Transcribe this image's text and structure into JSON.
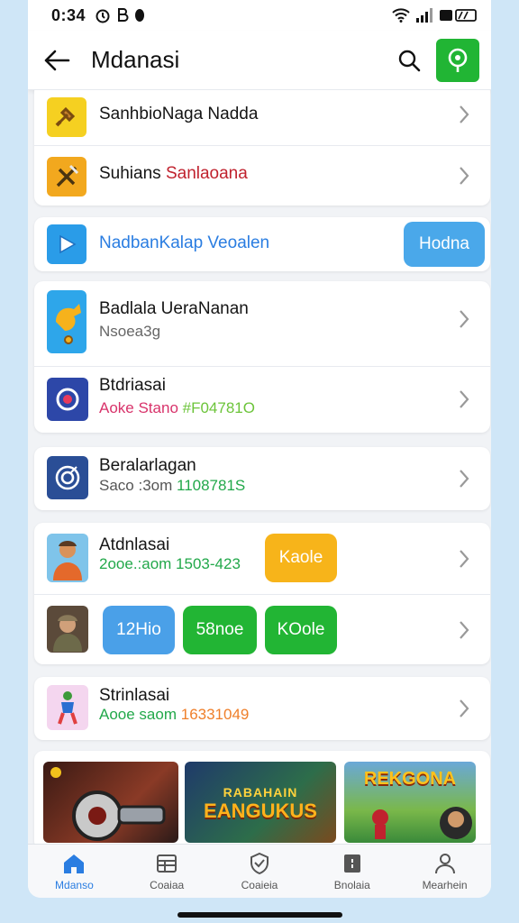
{
  "status_bar": {
    "time": "0:34",
    "left_icons": [
      "alarm-icon",
      "b-icon",
      "dot-icon"
    ],
    "right_icons": [
      "wifi-icon",
      "signal-icon",
      "battery-icon"
    ]
  },
  "header": {
    "title": "Mdanasi"
  },
  "card1": {
    "items": [
      {
        "title": "SanhbioNaga Nadda",
        "icon": "hammer-icon",
        "icon_bg": "#f5d021"
      },
      {
        "title_a": "Suhians ",
        "title_b": "Sanlaoana",
        "title_b_color": "#c0222e",
        "icon": "cross-tools-icon",
        "icon_bg": "#f2a81e"
      }
    ]
  },
  "card2": {
    "title": "NadbanKalap Veoalen",
    "title_color": "#2a7de1",
    "icon": "play-icon",
    "icon_bg": "#2a9ce8",
    "button": "Hodna",
    "button_color": "#4aa8ea"
  },
  "card3": {
    "items": [
      {
        "title": "Badlala UeraNanan",
        "sub": "Nsoea3g",
        "sub_color": "#666666",
        "icon": "rooster-icon",
        "icon_bg": "#2ea6ea"
      },
      {
        "title": "Btdriasai",
        "sub_a": "Aoke Stano ",
        "sub_b": "#F04781O",
        "sub_a_color": "#d8326a",
        "sub_b_color": "#6cc43a",
        "icon": "target-icon",
        "icon_bg": "#2d47a8"
      }
    ]
  },
  "card4": {
    "title": "Beralarlagan",
    "sub_a": "Saco :3om ",
    "sub_b": "1108781S",
    "sub_a_color": "#555555",
    "sub_b_color": "#22a84a",
    "icon": "ring-icon",
    "icon_bg": "#2a4e96"
  },
  "card5": {
    "row1": {
      "title": "Atdnlasai",
      "sub": "2ooe.:aom 1503-423",
      "sub_color": "#22a84a",
      "icon": "person-avatar-icon",
      "button": "Kaole",
      "button_color": "#f7b41a"
    },
    "row2": {
      "icon": "soldier-avatar-icon",
      "buttons": [
        {
          "label": "12Hio",
          "color": "#4aa0e8"
        },
        {
          "label": "58noe",
          "color": "#22b534"
        },
        {
          "label": "KOole",
          "color": "#22b534"
        }
      ]
    }
  },
  "card6": {
    "title": "Strinlasai",
    "sub_a": "Aooe saom ",
    "sub_b": "16331049",
    "sub_a_color": "#22a84a",
    "sub_b_color": "#ef7f2a",
    "icon": "runner-icon",
    "icon_bg": "#f4d6ef"
  },
  "banners": [
    {
      "name": "robot-game-banner",
      "text": ""
    },
    {
      "name": "fantasy-game-banner",
      "text_line1": "RABAHAIN",
      "text_line2": "EANGUKUS"
    },
    {
      "name": "soccer-game-banner",
      "text_line1": "REKGONA",
      "text_line2": ""
    }
  ],
  "bottom_nav": [
    {
      "label": "Mdanso",
      "icon": "home-icon",
      "active": true
    },
    {
      "label": "Coaiaa",
      "icon": "table-icon",
      "active": false
    },
    {
      "label": "Coaieia",
      "icon": "shield-check-icon",
      "active": false
    },
    {
      "label": "Bnolaia",
      "icon": "storage-icon",
      "active": false
    },
    {
      "label": "Mearhein",
      "icon": "person-icon",
      "active": false
    }
  ],
  "colors": {
    "accent": "#2a7de1",
    "green": "#21b534"
  }
}
